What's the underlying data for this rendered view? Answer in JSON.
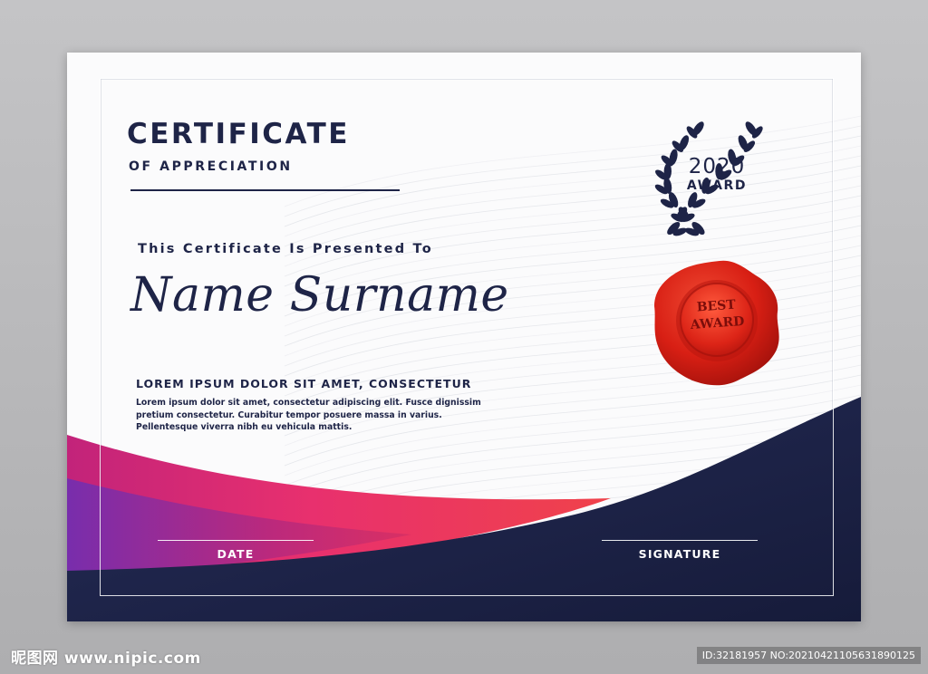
{
  "certificate": {
    "title": "CERTIFICATE",
    "subtitle": "OF APPRECIATION",
    "presented_to": "This Certificate Is Presented To",
    "recipient_name": "Name Surname",
    "heading": "LOREM IPSUM DOLOR SIT AMET, CONSECTETUR",
    "body_lines": [
      "Lorem ipsum dolor sit amet, consectetur adipiscing elit. Fusce dignissim",
      "pretium consectetur. Curabitur tempor posuere massa in varius.",
      "Pellentesque viverra nibh eu vehicula mattis."
    ],
    "date_label": "DATE",
    "signature_label": "SIGNATURE"
  },
  "award": {
    "year": "2020",
    "word": "AWARD",
    "seal_line1": "BEST",
    "seal_line2": "AWARD"
  },
  "colors": {
    "navy": "#1e2447",
    "pink": "#e8306e",
    "purple": "#7a2fb0",
    "seal_red": "#d81f14"
  },
  "watermark": {
    "left": "昵图网 www.nipic.com",
    "right": "ID:32181957 NO:20210421105631890125"
  }
}
